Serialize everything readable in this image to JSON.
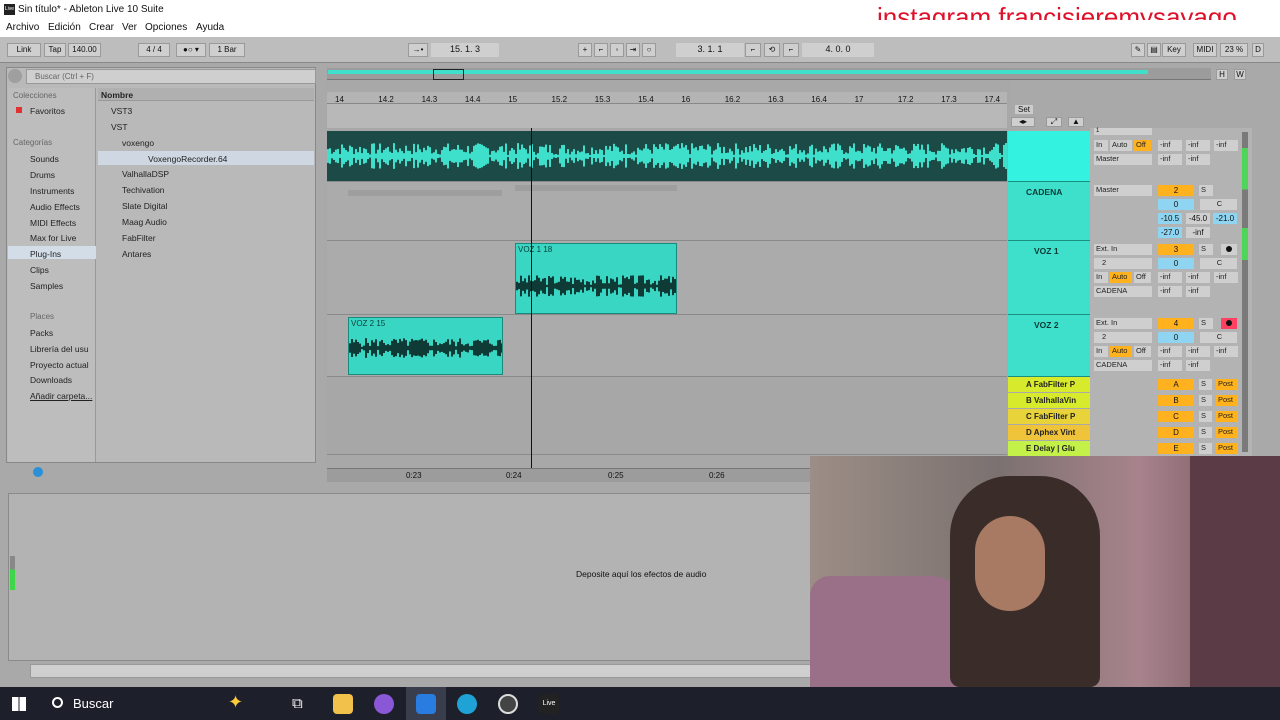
{
  "window": {
    "title": "Sin título* - Ableton Live 10 Suite",
    "overlay_text": "instagram francisjeremysayago"
  },
  "menu": [
    "Archivo",
    "Edición",
    "Crear",
    "Ver",
    "Opciones",
    "Ayuda"
  ],
  "transport": {
    "link": "Link",
    "tap": "Tap",
    "tempo": "140.00",
    "signature": "4 / 4",
    "quantize": "1 Bar",
    "position": "15. 1. 3",
    "loop_start": "3. 1. 1",
    "loop_length": "4. 0. 0",
    "key": "Key",
    "midi": "MIDI",
    "cpu": "23 %",
    "d": "D"
  },
  "browser": {
    "search_placeholder": "Buscar (Ctrl + F)",
    "collections_header": "Colecciones",
    "favorites": "Favoritos",
    "categories_header": "Categorías",
    "categories": [
      "Sounds",
      "Drums",
      "Instruments",
      "Audio Effects",
      "MIDI Effects",
      "Max for Live",
      "Plug-Ins",
      "Clips",
      "Samples"
    ],
    "places_header": "Places",
    "places": [
      "Packs",
      "Librería del usu",
      "Proyecto actual",
      "Downloads",
      "Añadir carpeta..."
    ],
    "name_header": "Nombre",
    "tree": [
      "VST3",
      "VST",
      "voxengo",
      "VoxengoRecorder.64",
      "ValhallaDSP",
      "Techivation",
      "Slate Digital",
      "Maag Audio",
      "FabFilter",
      "Antares"
    ]
  },
  "ruler": [
    "14",
    "14.2",
    "14.3",
    "14.4",
    "15",
    "15.2",
    "15.3",
    "15.4",
    "16",
    "16.2",
    "16.3",
    "16.4",
    "17",
    "17.2",
    "17.3",
    "17.4"
  ],
  "time_ruler": [
    "0:23",
    "0:24",
    "0:25",
    "0:26"
  ],
  "set_label": "Set",
  "tracks": [
    {
      "name": "",
      "input": "1",
      "vol": "-inf",
      "routing": "Master"
    },
    {
      "name": "CADENA",
      "routing": "Master",
      "num": "2",
      "vol": "0",
      "pan": "C",
      "meters": [
        "-10.5",
        "-45.0",
        "-21.0",
        "-27.0",
        "-inf"
      ]
    },
    {
      "name": "VOZ 1",
      "input": "Ext. In",
      "channel": "2",
      "num": "3",
      "vol": "0",
      "pan": "C",
      "routing": "CADENA",
      "clip": "VOZ 1 18"
    },
    {
      "name": "VOZ 2",
      "input": "Ext. In",
      "channel": "2",
      "num": "4",
      "vol": "0",
      "pan": "C",
      "routing": "CADENA",
      "clip": "VOZ 2 15"
    }
  ],
  "monitor": {
    "in": "In",
    "auto": "Auto",
    "off": "Off"
  },
  "returns": [
    {
      "name": "A FabFilter P",
      "letter": "A"
    },
    {
      "name": "B ValhallaVin",
      "letter": "B"
    },
    {
      "name": "C FabFilter P",
      "letter": "C"
    },
    {
      "name": "D Aphex Vint",
      "letter": "D"
    },
    {
      "name": "E Delay | Glu",
      "letter": "E"
    }
  ],
  "return_controls": {
    "solo": "S",
    "post": "Post",
    "minus_inf": "-inf"
  },
  "device_panel": {
    "drop_text": "Deposite aquí los efectos de audio"
  },
  "taskbar": {
    "search": "Buscar"
  },
  "colors": {
    "clip": "#39d6c3",
    "track_header": "#3ee0cc",
    "return": "#d7ea2b",
    "number": "#ffb21e"
  }
}
